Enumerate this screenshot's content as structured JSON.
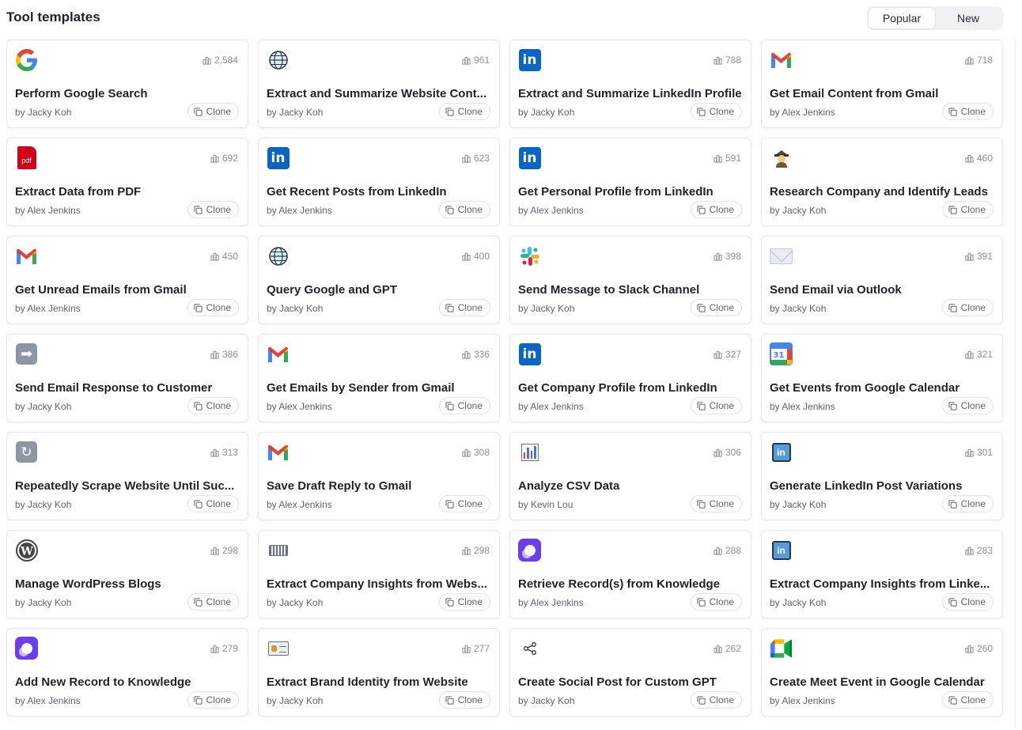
{
  "header": {
    "title": "Tool templates",
    "tabs": [
      {
        "label": "Popular",
        "active": true
      },
      {
        "label": "New",
        "active": false
      }
    ]
  },
  "clone_label": "Clone",
  "templates": [
    {
      "title": "Perform Google Search",
      "author": "by Jacky Koh",
      "count": "2,584",
      "icon": "google-icon"
    },
    {
      "title": "Extract and Summarize Website Cont...",
      "author": "by Jacky Koh",
      "count": "961",
      "icon": "globe-icon"
    },
    {
      "title": "Extract and Summarize LinkedIn Profile",
      "author": "by Jacky Koh",
      "count": "788",
      "icon": "linkedin-icon"
    },
    {
      "title": "Get Email Content from Gmail",
      "author": "by Alex Jenkins",
      "count": "718",
      "icon": "gmail-icon"
    },
    {
      "title": "Extract Data from PDF",
      "author": "by Alex Jenkins",
      "count": "692",
      "icon": "pdf-icon"
    },
    {
      "title": "Get Recent Posts from LinkedIn",
      "author": "by Alex Jenkins",
      "count": "623",
      "icon": "linkedin-icon"
    },
    {
      "title": "Get Personal Profile from LinkedIn",
      "author": "by Alex Jenkins",
      "count": "591",
      "icon": "linkedin-icon"
    },
    {
      "title": "Research Company and Identify Leads",
      "author": "by Jacky Koh",
      "count": "460",
      "icon": "detective-icon"
    },
    {
      "title": "Get Unread Emails from Gmail",
      "author": "by Alex Jenkins",
      "count": "450",
      "icon": "gmail-icon"
    },
    {
      "title": "Query Google and GPT",
      "author": "by Jacky Koh",
      "count": "400",
      "icon": "globe-icon"
    },
    {
      "title": "Send Message to Slack Channel",
      "author": "by Jacky Koh",
      "count": "398",
      "icon": "slack-icon"
    },
    {
      "title": "Send Email via Outlook",
      "author": "by Jacky Koh",
      "count": "391",
      "icon": "envelope-icon"
    },
    {
      "title": "Send Email Response to Customer",
      "author": "by Jacky Koh",
      "count": "386",
      "icon": "arrow-right-icon"
    },
    {
      "title": "Get Emails by Sender from Gmail",
      "author": "by Alex Jenkins",
      "count": "336",
      "icon": "gmail-icon"
    },
    {
      "title": "Get Company Profile from LinkedIn",
      "author": "by Alex Jenkins",
      "count": "327",
      "icon": "linkedin-icon"
    },
    {
      "title": "Get Events from Google Calendar",
      "author": "by Alex Jenkins",
      "count": "321",
      "icon": "google-calendar-icon"
    },
    {
      "title": "Repeatedly Scrape Website Until Suc...",
      "author": "by Jacky Koh",
      "count": "313",
      "icon": "repeat-icon"
    },
    {
      "title": "Save Draft Reply to Gmail",
      "author": "by Alex Jenkins",
      "count": "308",
      "icon": "gmail-icon"
    },
    {
      "title": "Analyze CSV Data",
      "author": "by Kevin Lou",
      "count": "306",
      "icon": "bar-chart-icon"
    },
    {
      "title": "Generate LinkedIn Post Variations",
      "author": "by Jacky Koh",
      "count": "301",
      "icon": "linkedin-outline-icon"
    },
    {
      "title": "Manage WordPress Blogs",
      "author": "by Jacky Koh",
      "count": "298",
      "icon": "wordpress-icon"
    },
    {
      "title": "Extract Company Insights from Webs...",
      "author": "by Jacky Koh",
      "count": "298",
      "icon": "keyboard-icon"
    },
    {
      "title": "Retrieve Record(s) from Knowledge",
      "author": "by Alex Jenkins",
      "count": "288",
      "icon": "knowledge-icon"
    },
    {
      "title": "Extract Company Insights from Linke...",
      "author": "by Jacky Koh",
      "count": "283",
      "icon": "linkedin-outline-icon"
    },
    {
      "title": "Add New Record to Knowledge",
      "author": "by Alex Jenkins",
      "count": "279",
      "icon": "knowledge-icon"
    },
    {
      "title": "Extract Brand Identity from Website",
      "author": "by Jacky Koh",
      "count": "277",
      "icon": "id-card-icon"
    },
    {
      "title": "Create Social Post for Custom GPT",
      "author": "by Jacky Koh",
      "count": "262",
      "icon": "share-icon"
    },
    {
      "title": "Create Meet Event in Google Calendar",
      "author": "by Alex Jenkins",
      "count": "260",
      "icon": "google-meet-icon"
    }
  ]
}
